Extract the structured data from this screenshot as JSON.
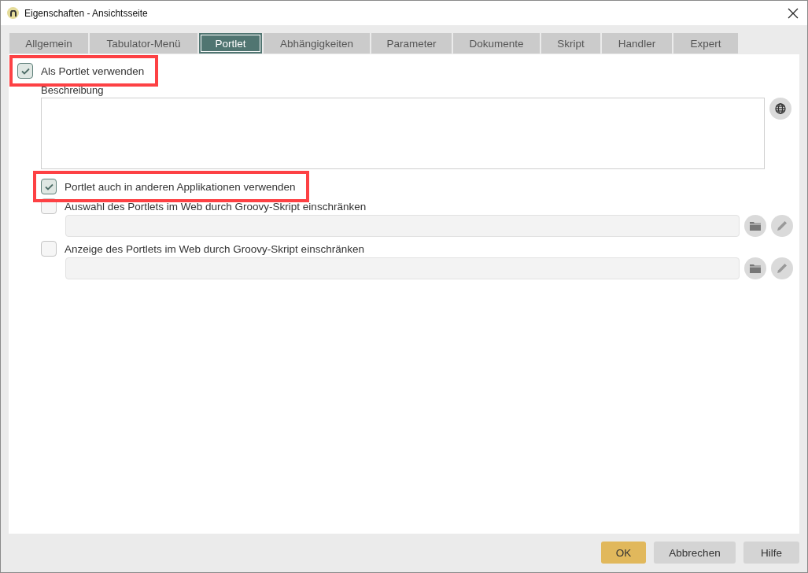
{
  "window": {
    "title": "Eigenschaften - Ansichtsseite"
  },
  "tabs": [
    {
      "label": "Allgemein",
      "selected": false
    },
    {
      "label": "Tabulator-Menü",
      "selected": false
    },
    {
      "label": "Portlet",
      "selected": true
    },
    {
      "label": "Abhängigkeiten",
      "selected": false
    },
    {
      "label": "Parameter",
      "selected": false
    },
    {
      "label": "Dokumente",
      "selected": false
    },
    {
      "label": "Skript",
      "selected": false
    },
    {
      "label": "Handler",
      "selected": false
    },
    {
      "label": "Expert",
      "selected": false
    }
  ],
  "options": [
    {
      "kind": "checkbox",
      "label": "Als Portlet verwenden",
      "checked": true,
      "highlighted": true,
      "children": [
        {
          "kind": "textarea",
          "label": "Beschreibung"
        },
        {
          "kind": "checkbox",
          "label": "Portlet auch in anderen Applikationen verwenden",
          "checked": true,
          "highlighted": true
        },
        {
          "kind": "script",
          "label": "Auswahl des Portlets im Web durch Groovy-Skript einschränken",
          "checked": false
        },
        {
          "kind": "script",
          "label": "Anzeige des Portlets im Web durch Groovy-Skript einschränken",
          "checked": false
        }
      ]
    }
  ],
  "buttons": [
    {
      "label": "OK",
      "kind": "primary"
    },
    {
      "label": "Abbrechen",
      "kind": "secondary"
    },
    {
      "label": "Hilfe",
      "kind": "secondary"
    }
  ]
}
